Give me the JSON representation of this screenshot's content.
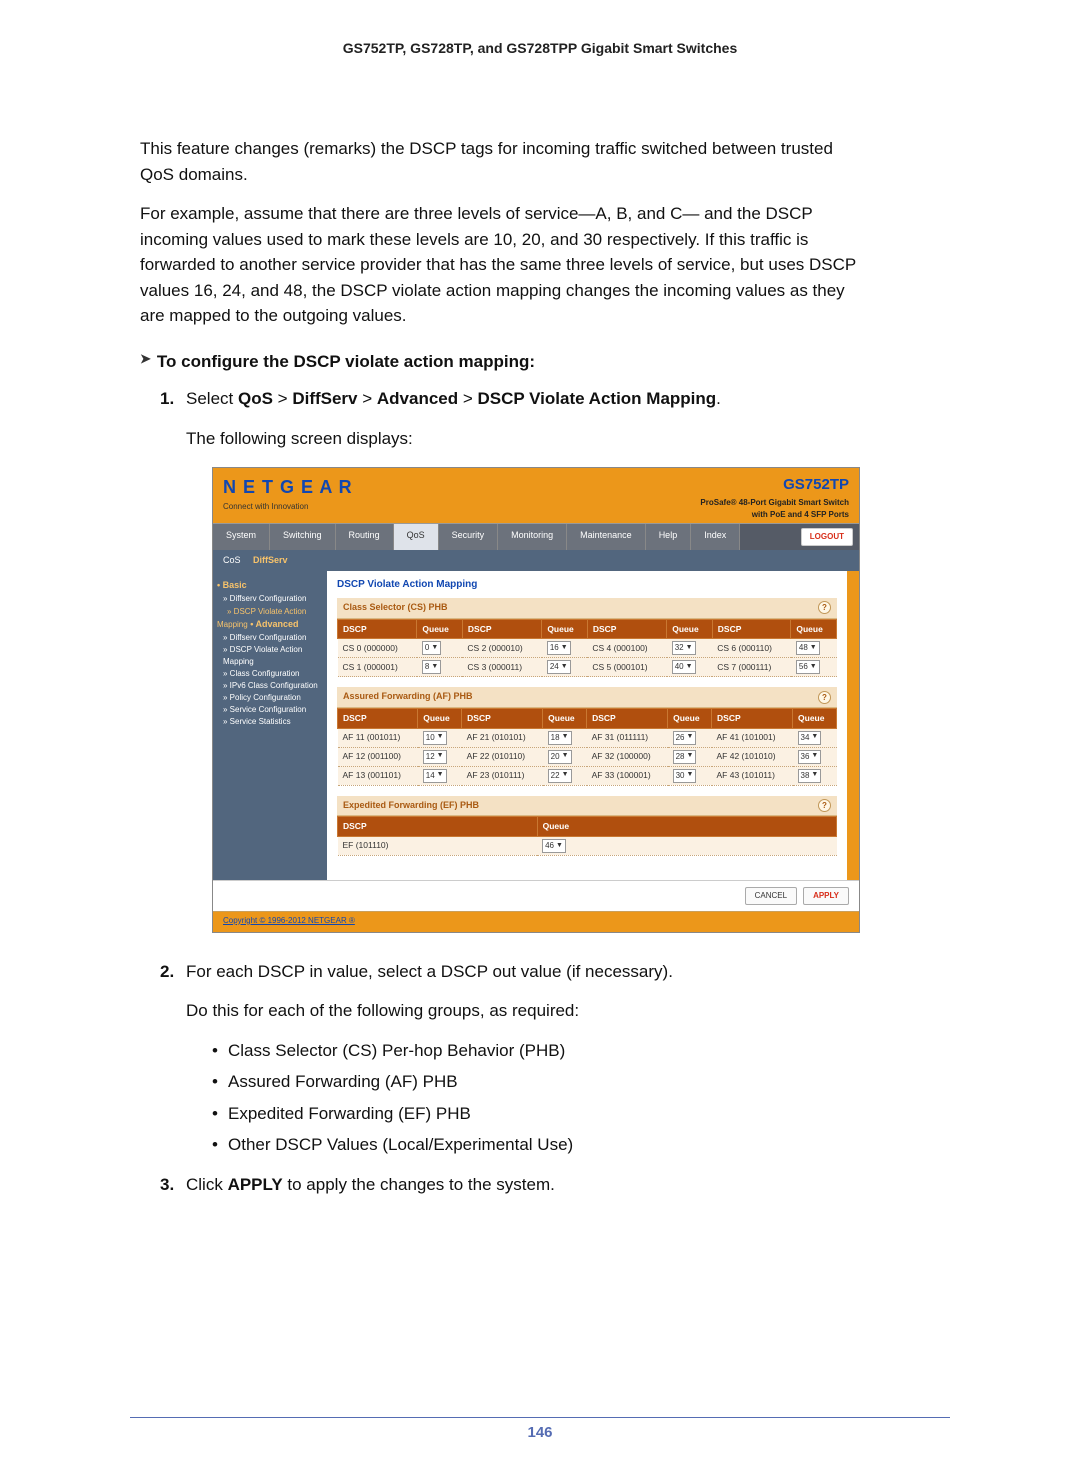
{
  "header": "GS752TP, GS728TP, and GS728TPP Gigabit Smart Switches",
  "intro1": "This feature changes (remarks) the DSCP tags for incoming traffic switched between trusted QoS domains.",
  "intro2": "For example, assume that there are three levels of service—A, B, and C— and the DSCP incoming values used to mark these levels are 10, 20, and 30 respectively. If this traffic is forwarded to another service provider that has the same three levels of service, but uses DSCP values 16, 24, and 48, the DSCP violate action mapping changes the incoming values as they are mapped to the outgoing values.",
  "proc_head": "To configure the DSCP violate action mapping:",
  "step1_pre": "Select ",
  "step1_path_a": "QoS",
  "step1_gt": " > ",
  "step1_path_b": "DiffServ",
  "step1_path_c": "Advanced",
  "step1_path_d": "DSCP Violate Action Mapping",
  "step1_post": ".",
  "step1_after": "The following screen displays:",
  "step2": "For each DSCP in value, select a DSCP out value (if necessary).",
  "step2_after": "Do this for each of the following groups, as required:",
  "bullets": [
    "Class Selector (CS) Per-hop Behavior (PHB)",
    "Assured Forwarding (AF) PHB",
    "Expedited Forwarding (EF) PHB",
    "Other DSCP Values (Local/Experimental Use)"
  ],
  "step3_pre": "Click ",
  "step3_bold": "APPLY",
  "step3_post": " to apply the changes to the system.",
  "page_num": "146",
  "shot": {
    "logo": "N E T G E A R",
    "logo_sub": "Connect with Innovation",
    "model": "GS752TP",
    "model_sub1": "ProSafe® 48-Port Gigabit Smart Switch",
    "model_sub2": "with PoE and 4 SFP Ports",
    "tabs": [
      "System",
      "Switching",
      "Routing",
      "QoS",
      "Security",
      "Monitoring",
      "Maintenance",
      "Help",
      "Index"
    ],
    "active_tab": "QoS",
    "logout": "LOGOUT",
    "subtabs_a": "CoS",
    "subtabs_b": "DiffServ",
    "sidebar": {
      "basic": "• Basic",
      "g1": "» Diffserv Configuration",
      "cur": "» DSCP Violate Action Mapping",
      "adv": "• Advanced",
      "items": [
        "» Diffserv Configuration",
        "» DSCP Violate Action Mapping",
        "» Class Configuration",
        "» IPv6 Class Configuration",
        "» Policy Configuration",
        "» Service Configuration",
        "» Service Statistics"
      ]
    },
    "title": "DSCP Violate Action Mapping",
    "cs_head": "Class Selector (CS) PHB",
    "af_head": "Assured Forwarding (AF) PHB",
    "ef_head": "Expedited Forwarding (EF) PHB",
    "col_dscp": "DSCP",
    "col_queue": "Queue",
    "cs_rows": [
      [
        "CS 0 (000000)",
        "0",
        "CS 2 (000010)",
        "16",
        "CS 4 (000100)",
        "32",
        "CS 6 (000110)",
        "48"
      ],
      [
        "CS 1 (000001)",
        "8",
        "CS 3 (000011)",
        "24",
        "CS 5 (000101)",
        "40",
        "CS 7 (000111)",
        "56"
      ]
    ],
    "af_rows": [
      [
        "AF 11 (001011)",
        "10",
        "AF 21 (010101)",
        "18",
        "AF 31 (011111)",
        "26",
        "AF 41 (101001)",
        "34"
      ],
      [
        "AF 12 (001100)",
        "12",
        "AF 22 (010110)",
        "20",
        "AF 32 (100000)",
        "28",
        "AF 42 (101010)",
        "36"
      ],
      [
        "AF 13 (001101)",
        "14",
        "AF 23 (010111)",
        "22",
        "AF 33 (100001)",
        "30",
        "AF 43 (101011)",
        "38"
      ]
    ],
    "ef_row": [
      "EF (101110)",
      "46"
    ],
    "cancel": "CANCEL",
    "apply": "APPLY",
    "copyright": "Copyright © 1996-2012 NETGEAR ®"
  }
}
